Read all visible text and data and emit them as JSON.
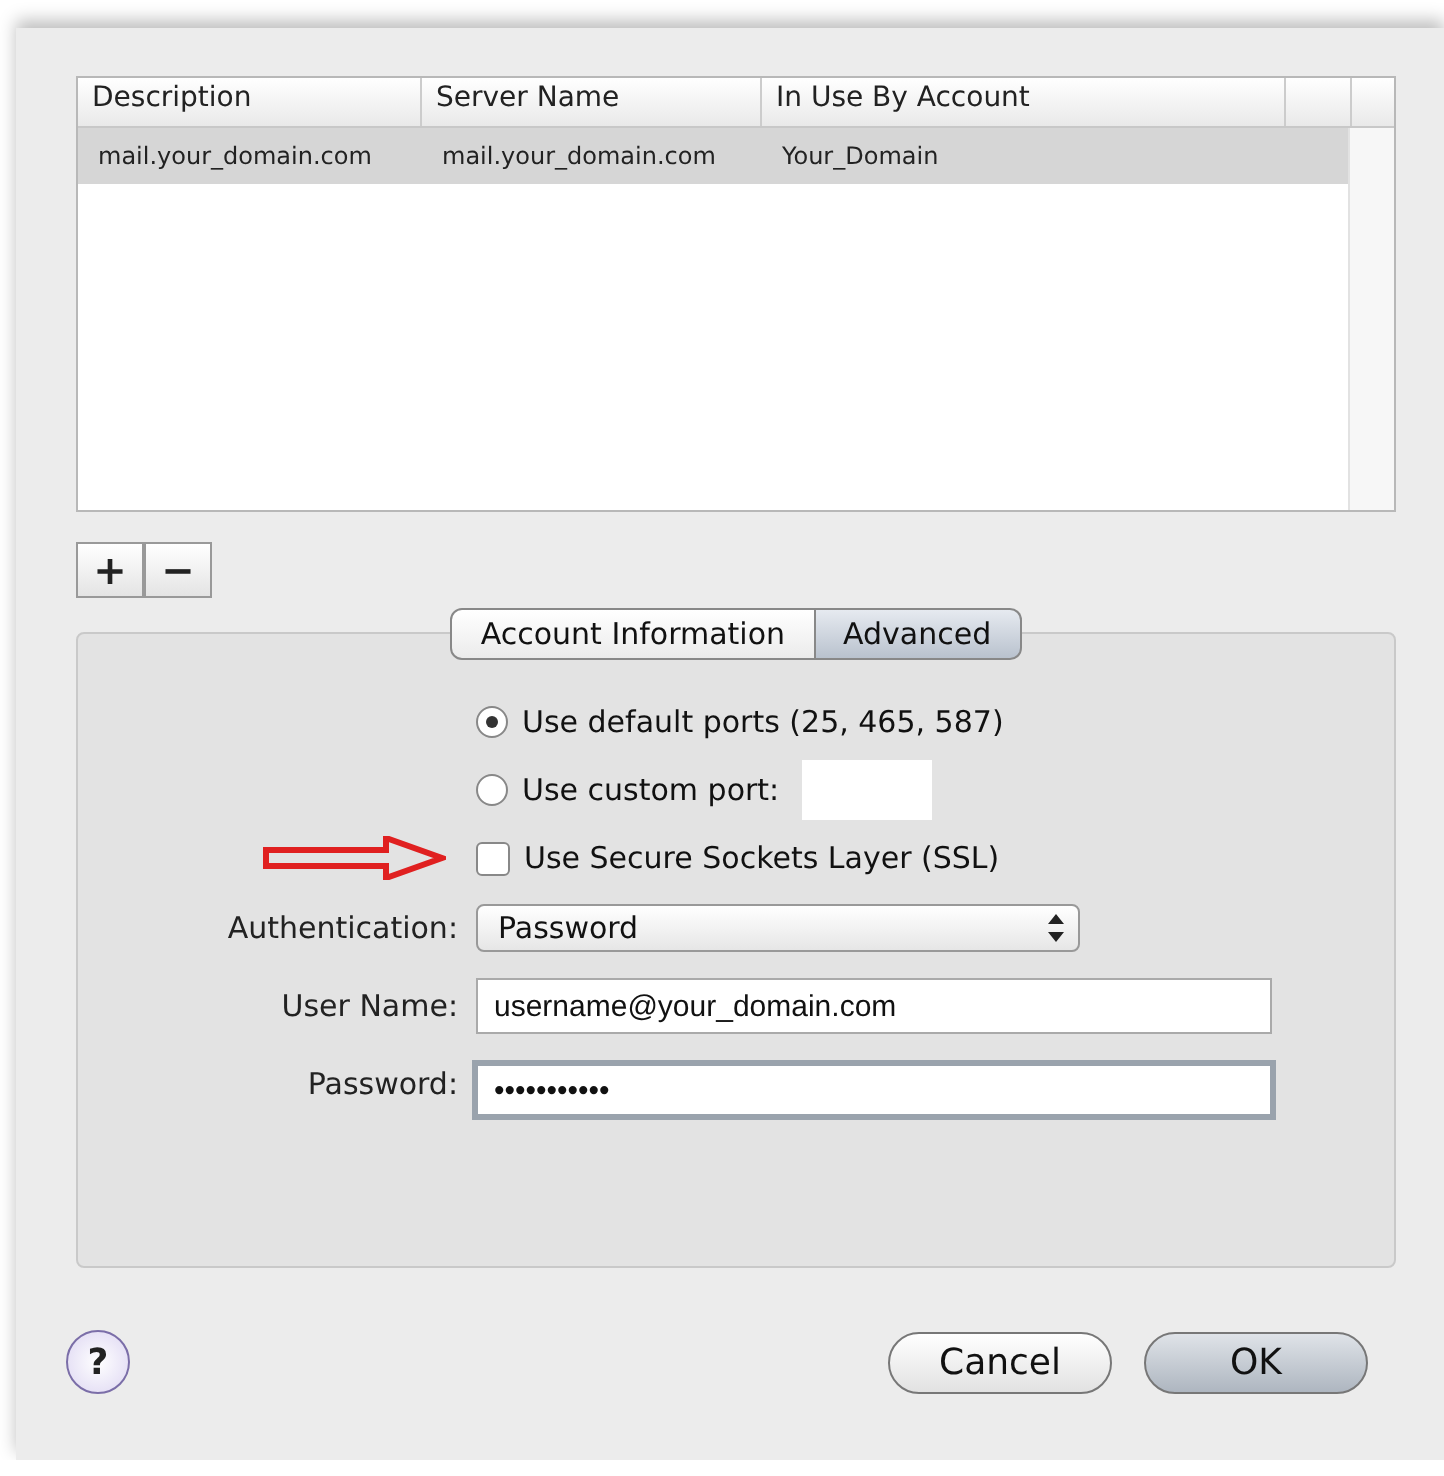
{
  "servers_table": {
    "columns": [
      "Description",
      "Server Name",
      "In Use By Account"
    ],
    "rows": [
      {
        "cells": [
          "mail.your_domain.com",
          "mail.your_domain.com",
          "Your_Domain"
        ],
        "selected": true
      }
    ]
  },
  "list_buttons": [
    "+",
    "−"
  ],
  "tabs": [
    {
      "label": "Account Information",
      "selected": false
    },
    {
      "label": "Advanced",
      "selected": true
    }
  ],
  "ports": [
    {
      "label": "Use default ports (25, 465, 587)",
      "selected": true,
      "kind": "plain"
    },
    {
      "label": "Use custom port:",
      "selected": false,
      "kind": "field"
    }
  ],
  "ssl": {
    "label": "Use Secure Sockets Layer (SSL)",
    "checked": false
  },
  "authentication": {
    "label": "Authentication:",
    "value": "Password"
  },
  "user_name": {
    "label": "User Name:",
    "value": "username@your_domain.com"
  },
  "password": {
    "label": "Password:",
    "value": "•••••••••••"
  },
  "help": "?",
  "buttons": [
    {
      "label": "Cancel",
      "default": false
    },
    {
      "label": "OK",
      "default": true
    }
  ]
}
